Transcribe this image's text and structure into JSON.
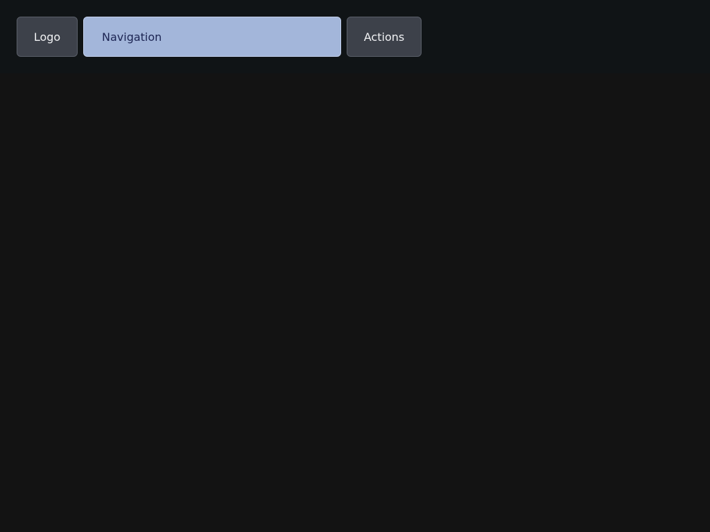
{
  "header": {
    "logo_label": "Logo",
    "navigation_label": "Navigation",
    "actions_label": "Actions"
  },
  "colors": {
    "page_background": "#131313",
    "header_background": "#101416",
    "button_background": "#3d414a",
    "navigation_background": "#a3b6da",
    "navigation_text": "#1c2452"
  }
}
